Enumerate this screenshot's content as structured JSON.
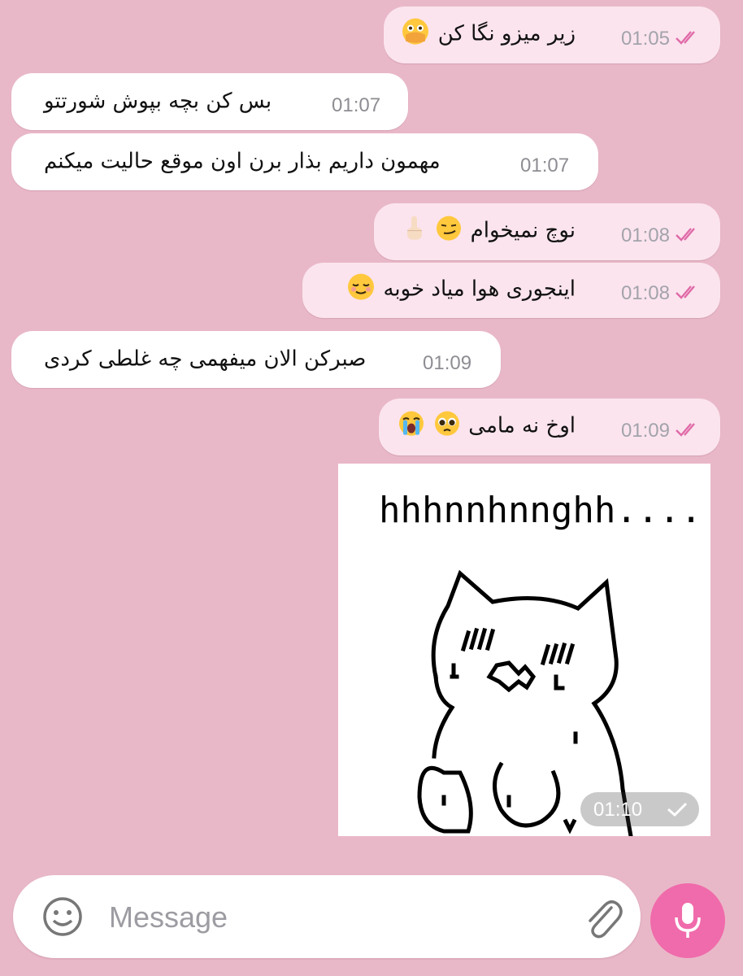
{
  "messages": [
    {
      "id": 1,
      "dir": "out",
      "text": "زیر میزو نگا کن",
      "emoji": [
        "face-with-open-eyes-and-hand-over-mouth"
      ],
      "time": "01:05",
      "status": "read"
    },
    {
      "id": 2,
      "dir": "in",
      "text": "بس کن بچه بپوش شورتتو",
      "time": "01:07"
    },
    {
      "id": 3,
      "dir": "in",
      "text": "مهمون داریم بذار برن اون موقع حالیت میکنم",
      "time": "01:07"
    },
    {
      "id": 4,
      "dir": "out",
      "text": "نوچ نمیخوام",
      "emoji": [
        "smirking-face",
        "index-pointing-up"
      ],
      "time": "01:08",
      "status": "read"
    },
    {
      "id": 5,
      "dir": "out",
      "text": "اینجوری هوا میاد خوبه",
      "emoji": [
        "relieved-face"
      ],
      "time": "01:08",
      "status": "read"
    },
    {
      "id": 6,
      "dir": "in",
      "text": "صبرکن الان میفهمی چه غلطی کردی",
      "time": "01:09"
    },
    {
      "id": 7,
      "dir": "out",
      "text": "اوخ نه مامی",
      "emoji": [
        "pleading-face",
        "loudly-crying-face"
      ],
      "time": "01:09",
      "status": "read"
    },
    {
      "id": 8,
      "dir": "out",
      "type": "image",
      "sticker_text": "hhhnnhnnghh....",
      "image_description": "hand-drawn cat sticker, distressed",
      "time": "01:10",
      "status": "sent"
    }
  ],
  "composer": {
    "placeholder": "Message"
  },
  "icons": {
    "emoji_button": "smiley-icon",
    "attach": "paperclip-icon",
    "send": "microphone-icon"
  },
  "colors": {
    "background": "#e9b8c8",
    "outgoing_bubble": "#fbe4ee",
    "incoming_bubble": "#ffffff",
    "accent": "#f06bab",
    "read_ticks": "#e06aa8"
  }
}
